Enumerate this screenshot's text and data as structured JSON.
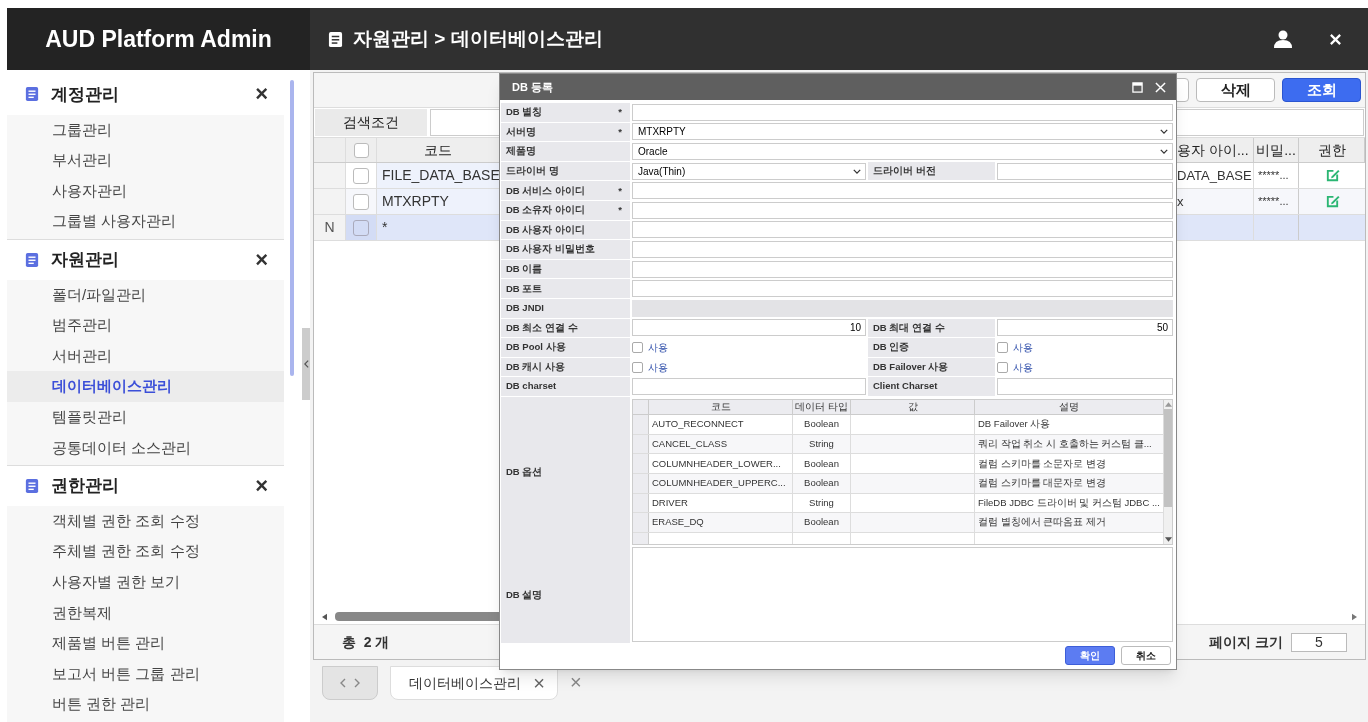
{
  "app_title": "AUD Platform Admin",
  "breadcrumb": "자원관리 > 데이터베이스관리",
  "sidebar": {
    "groups": [
      {
        "title": "계정관리",
        "close": "×",
        "items": [
          {
            "label": "그룹관리",
            "selected": false
          },
          {
            "label": "부서관리",
            "selected": false
          },
          {
            "label": "사용자관리",
            "selected": false
          },
          {
            "label": "그룹별 사용자관리",
            "selected": false
          }
        ]
      },
      {
        "title": "자원관리",
        "close": "×",
        "items": [
          {
            "label": "폴더/파일관리",
            "selected": false
          },
          {
            "label": "범주관리",
            "selected": false
          },
          {
            "label": "서버관리",
            "selected": false
          },
          {
            "label": "데이터베이스관리",
            "selected": true
          },
          {
            "label": "템플릿관리",
            "selected": false
          },
          {
            "label": "공통데이터 소스관리",
            "selected": false
          }
        ]
      },
      {
        "title": "권한관리",
        "close": "×",
        "items": [
          {
            "label": "객체별 권한 조회 수정",
            "selected": false
          },
          {
            "label": "주체별 권한 조회 수정",
            "selected": false
          },
          {
            "label": "사용자별 권한 보기",
            "selected": false
          },
          {
            "label": "권한복제",
            "selected": false
          },
          {
            "label": "제품별 버튼 관리",
            "selected": false
          },
          {
            "label": "보고서 버튼 그룹 관리",
            "selected": false
          },
          {
            "label": "버튼 권한 관리",
            "selected": false
          }
        ]
      }
    ]
  },
  "toolbar": {
    "buttons": [
      {
        "kind": "default"
      },
      {
        "kind": "default",
        "label": "삭제"
      },
      {
        "kind": "primary",
        "label": "조회"
      }
    ]
  },
  "search": {
    "label": "검색조건"
  },
  "grid": {
    "select_all_checked": false,
    "columns": [
      "코드",
      "용자 아이...",
      "비밀...",
      "권한"
    ],
    "rows": [
      {
        "kind": "data",
        "checked": false,
        "code": "FILE_DATA_BASE",
        "user_id": "DATA_BASE",
        "password": "*****..."
      },
      {
        "kind": "data",
        "checked": false,
        "code": "MTXRPTY",
        "user_id": "x",
        "password": "*****..."
      },
      {
        "kind": "new",
        "marker": "N",
        "checked": false,
        "code": "*"
      }
    ]
  },
  "footer": {
    "total": "총  2 개",
    "page_size_label": "페이지 크기",
    "page_size": "5"
  },
  "tabs": [
    {
      "label": "데이터베이스관리",
      "close": "×",
      "selected": true
    }
  ],
  "close_all": "×",
  "dialog": {
    "title": "DB 등록",
    "rows": [
      {
        "fields": [
          {
            "kind": "text",
            "label": "DB 별칭",
            "mark": "*",
            "disabled": false
          }
        ]
      },
      {
        "fields": [
          {
            "kind": "select",
            "label": "서버명",
            "mark": "*",
            "value": "MTXRPTY"
          }
        ]
      },
      {
        "fields": [
          {
            "kind": "select",
            "label": "제품명",
            "value": "Oracle"
          }
        ]
      },
      {
        "fields": [
          {
            "kind": "select",
            "label": "드라이버 명",
            "value": "Java(Thin)"
          },
          {
            "kind": "text",
            "label": "드라이버 버전",
            "disabled": false
          }
        ]
      },
      {
        "fields": [
          {
            "kind": "text",
            "label": "DB 서비스 아이디",
            "mark": "*",
            "disabled": false
          }
        ]
      },
      {
        "fields": [
          {
            "kind": "text",
            "label": "DB 소유자 아이디",
            "mark": "*",
            "disabled": false
          }
        ]
      },
      {
        "fields": [
          {
            "kind": "text",
            "label": "DB 사용자 아이디",
            "disabled": false
          }
        ]
      },
      {
        "fields": [
          {
            "kind": "text",
            "label": "DB 사용자 비밀번호",
            "disabled": false
          }
        ]
      },
      {
        "fields": [
          {
            "kind": "text",
            "label": "DB 이름",
            "disabled": false
          }
        ]
      },
      {
        "fields": [
          {
            "kind": "text",
            "label": "DB 포트",
            "disabled": false
          }
        ]
      },
      {
        "fields": [
          {
            "kind": "text",
            "label": "DB JNDI",
            "disabled": true
          }
        ]
      },
      {
        "fields": [
          {
            "kind": "number",
            "label": "DB 최소 연결 수",
            "value": "10"
          },
          {
            "kind": "number",
            "label": "DB 최대 연결 수",
            "value": "50"
          }
        ]
      },
      {
        "fields": [
          {
            "kind": "checkbox",
            "label": "DB Pool 사용",
            "option": "사용",
            "checked": false
          },
          {
            "kind": "checkbox",
            "label": "DB 인증",
            "option": "사용",
            "checked": false
          }
        ]
      },
      {
        "fields": [
          {
            "kind": "checkbox",
            "label": "DB 캐시 사용",
            "option": "사용",
            "checked": false
          },
          {
            "kind": "checkbox",
            "label": "DB Failover 사용",
            "option": "사용",
            "checked": false
          }
        ]
      },
      {
        "fields": [
          {
            "kind": "text",
            "label": "DB charset",
            "disabled": false
          },
          {
            "kind": "text",
            "label": "Client Charset",
            "disabled": false
          }
        ]
      }
    ],
    "options": {
      "label": "DB 옵션",
      "columns": [
        "코드",
        "데이터 타입",
        "값",
        "설명"
      ],
      "rows": [
        [
          "AUTO_RECONNECT",
          "Boolean",
          "",
          "DB Failover 사용"
        ],
        [
          "CANCEL_CLASS",
          "String",
          "",
          "쿼리 작업 취소 시 호출하는 커스텀 클..."
        ],
        [
          "COLUMNHEADER_LOWER...",
          "Boolean",
          "",
          "컬럼 스키마를 소문자로 변경"
        ],
        [
          "COLUMNHEADER_UPPERC...",
          "Boolean",
          "",
          "컬럼 스키마를 대문자로 변경"
        ],
        [
          "DRIVER",
          "String",
          "",
          "FileDB JDBC 드라이버 및 커스텀 JDBC ..."
        ],
        [
          "ERASE_DQ",
          "Boolean",
          "",
          "컬럼 별칭에서 큰따옴표 제거"
        ]
      ]
    },
    "description_label": "DB 설명",
    "buttons": [
      {
        "kind": "primary",
        "label": "확인"
      },
      {
        "kind": "default",
        "label": "취소"
      }
    ]
  }
}
